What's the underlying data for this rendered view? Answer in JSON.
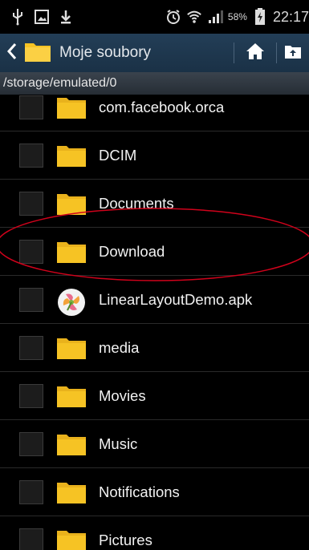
{
  "status_bar": {
    "battery_percent": "58%",
    "time": "22:17"
  },
  "action_bar": {
    "title": "Moje soubory"
  },
  "path_bar": {
    "path": "/storage/emulated/0"
  },
  "files": [
    {
      "name": "com.facebook.orca",
      "type": "folder"
    },
    {
      "name": "DCIM",
      "type": "folder"
    },
    {
      "name": "Documents",
      "type": "folder"
    },
    {
      "name": "Download",
      "type": "folder"
    },
    {
      "name": "LinearLayoutDemo.apk",
      "type": "apk"
    },
    {
      "name": "media",
      "type": "folder"
    },
    {
      "name": "Movies",
      "type": "folder"
    },
    {
      "name": "Music",
      "type": "folder"
    },
    {
      "name": "Notifications",
      "type": "folder"
    },
    {
      "name": "Pictures",
      "type": "folder"
    }
  ],
  "colors": {
    "folder": "#f6c324",
    "action_bar": "#1f374d",
    "annotation": "#d0021b"
  }
}
